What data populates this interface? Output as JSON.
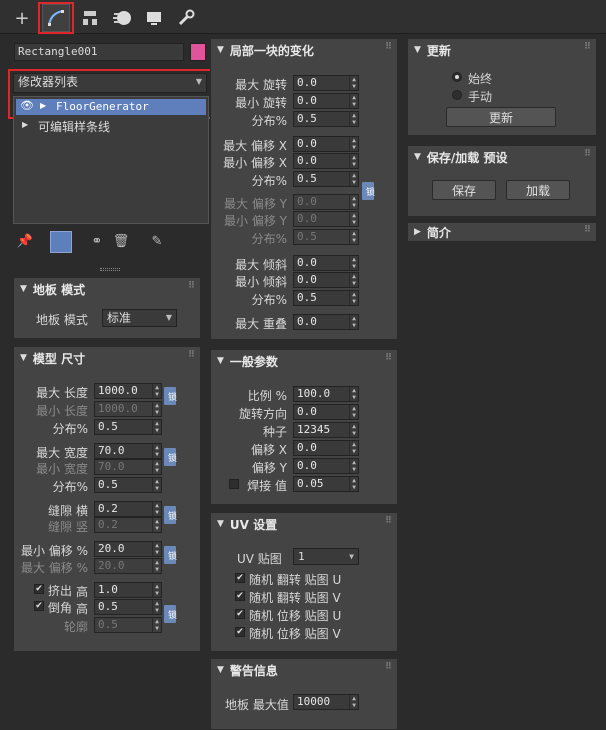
{
  "tabs": [
    {
      "name": "create",
      "icon": "plus-icon"
    },
    {
      "name": "modify",
      "icon": "modify-icon"
    },
    {
      "name": "hierarchy",
      "icon": "hierarchy-icon"
    },
    {
      "name": "motion",
      "icon": "motion-icon"
    },
    {
      "name": "display",
      "icon": "display-icon"
    },
    {
      "name": "utilities",
      "icon": "wrench-icon"
    }
  ],
  "object": {
    "name": "Rectangle001",
    "color": "#e0559a"
  },
  "modifier_list": {
    "label": "修改器列表"
  },
  "stack": [
    {
      "label": "FloorGenerator",
      "selected": true
    },
    {
      "label": "可编辑样条线",
      "selected": false
    }
  ],
  "floor_mode": {
    "title": "地板 模式",
    "label": "地板 模式",
    "value": "标准"
  },
  "model_size": {
    "title": "模型 尺寸",
    "lock": "锁",
    "rows": [
      {
        "label": "最大 长度",
        "value": "1000.0",
        "disabled": false
      },
      {
        "label": "最小 长度",
        "value": "1000.0",
        "disabled": true
      },
      {
        "label": "分布%",
        "value": "0.5",
        "disabled": false
      },
      {
        "label": "最大 宽度",
        "value": "70.0",
        "disabled": false
      },
      {
        "label": "最小 宽度",
        "value": "70.0",
        "disabled": true
      },
      {
        "label": "分布%",
        "value": "0.5",
        "disabled": false
      },
      {
        "label": "缝隙 横",
        "value": "0.2",
        "disabled": false
      },
      {
        "label": "缝隙 竖",
        "value": "0.2",
        "disabled": true
      },
      {
        "label": "最小 偏移 %",
        "value": "20.0",
        "disabled": false
      },
      {
        "label": "最大 偏移 %",
        "value": "20.0",
        "disabled": true
      },
      {
        "label": "高",
        "value": "1.0",
        "disabled": false,
        "check": "挤出"
      },
      {
        "label": "高",
        "value": "0.5",
        "disabled": false,
        "check": "倒角"
      },
      {
        "label": "轮廓",
        "value": "0.5",
        "disabled": true
      }
    ]
  },
  "local_change": {
    "title": "局部一块的变化",
    "lock": "锁",
    "rows": [
      {
        "label": "最大 旋转",
        "value": "0.0",
        "disabled": false
      },
      {
        "label": "最小 旋转",
        "value": "0.0",
        "disabled": false
      },
      {
        "label": "分布%",
        "value": "0.5",
        "disabled": false
      },
      {
        "label": "最大 偏移 X",
        "value": "0.0",
        "disabled": false
      },
      {
        "label": "最小 偏移 X",
        "value": "0.0",
        "disabled": false
      },
      {
        "label": "分布%",
        "value": "0.5",
        "disabled": false
      },
      {
        "label": "最大 偏移 Y",
        "value": "0.0",
        "disabled": true
      },
      {
        "label": "最小 偏移 Y",
        "value": "0.0",
        "disabled": true
      },
      {
        "label": "分布%",
        "value": "0.5",
        "disabled": true
      },
      {
        "label": "最大 倾斜",
        "value": "0.0",
        "disabled": false
      },
      {
        "label": "最小 倾斜",
        "value": "0.0",
        "disabled": false
      },
      {
        "label": "分布%",
        "value": "0.5",
        "disabled": false
      },
      {
        "label": "最大 重叠",
        "value": "0.0",
        "disabled": false
      }
    ]
  },
  "general": {
    "title": "一般参数",
    "rows": [
      {
        "label": "比例 %",
        "value": "100.0"
      },
      {
        "label": "旋转方向",
        "value": "0.0"
      },
      {
        "label": "种子",
        "value": "12345"
      },
      {
        "label": "偏移 X",
        "value": "0.0"
      },
      {
        "label": "偏移 Y",
        "value": "0.0"
      },
      {
        "label": "焊接 值",
        "value": "0.05"
      }
    ]
  },
  "uv": {
    "title": "UV 设置",
    "map_label": "UV 贴图",
    "map_value": "1",
    "checks": [
      "随机 翻转 贴图 U",
      "随机 翻转 贴图 V",
      "随机 位移 贴图 U",
      "随机 位移 贴图 V"
    ]
  },
  "warning": {
    "title": "警告信息",
    "label": "地板 最大值",
    "value": "10000"
  },
  "update": {
    "title": "更新",
    "radio_always": "始终",
    "radio_manual": "手动",
    "button": "更新"
  },
  "saveload": {
    "title": "保存/加载 预设",
    "save": "保存",
    "load": "加载"
  },
  "intro": {
    "title": "简介"
  }
}
